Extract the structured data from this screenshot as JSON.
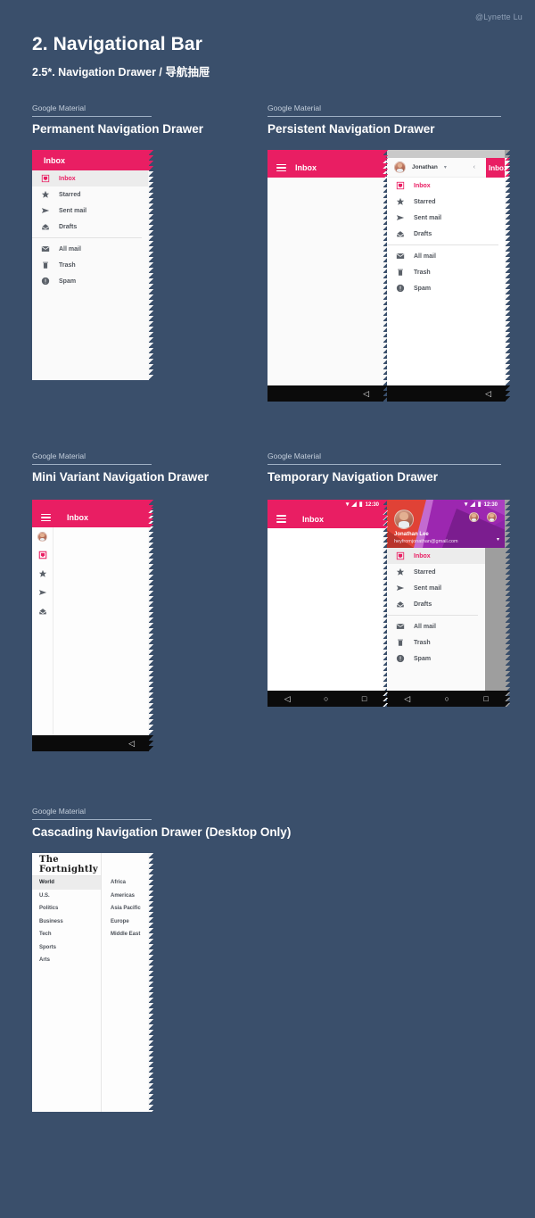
{
  "meta": {
    "author": "@Lynette Lu",
    "title": "2. Navigational Bar",
    "subtitle": "2.5*. Navigation Drawer / 导航抽屉",
    "kicker": "Google Material",
    "accent_pink": "#E91E63",
    "background": "#3A4F6B"
  },
  "sections": [
    {
      "kicker": "Google Material",
      "title": "Permanent Navigation Drawer"
    },
    {
      "kicker": "Google Material",
      "title": "Persistent Navigation Drawer"
    },
    {
      "kicker": "Google Material",
      "title": "Mini Variant Navigation Drawer"
    },
    {
      "kicker": "Google Material",
      "title": "Temporary Navigation Drawer"
    },
    {
      "kicker": "Google Material",
      "title": "Cascading Navigation Drawer (Desktop Only)"
    }
  ],
  "appbar": {
    "title": "Inbox",
    "menu_icon": "hamburger-icon"
  },
  "statusbar": {
    "time": "12:30",
    "wifi_icon": "wifi-icon",
    "signal_icon": "signal-icon",
    "battery_icon": "battery-icon"
  },
  "androidnav": {
    "back": "back-icon",
    "home": "home-icon",
    "recents": "recents-icon"
  },
  "mail_items": [
    {
      "label": "Inbox",
      "icon": "inbox-icon",
      "selected": true
    },
    {
      "label": "Starred",
      "icon": "star-icon",
      "selected": false
    },
    {
      "label": "Sent mail",
      "icon": "send-icon",
      "selected": false
    },
    {
      "label": "Drafts",
      "icon": "drafts-icon",
      "selected": false
    },
    {
      "label": "All mail",
      "icon": "mail-icon",
      "selected": false
    },
    {
      "label": "Trash",
      "icon": "trash-icon",
      "selected": false
    },
    {
      "label": "Spam",
      "icon": "info-icon",
      "selected": false
    }
  ],
  "mini_icons": [
    "avatar-icon",
    "inbox-icon",
    "star-icon",
    "send-icon",
    "drafts-icon"
  ],
  "persistent_account": {
    "name": "Jonathan",
    "caret": "▾",
    "collapse_icon": "‹"
  },
  "temporary_account": {
    "name": "Jonathan Lee",
    "email": "heyfromjonathan@gmail.com",
    "caret": "▾"
  },
  "cascading": {
    "masthead": "The Fortnightly",
    "primary": [
      "World",
      "U.S.",
      "Politics",
      "Business",
      "Tech",
      "Sports",
      "Arts"
    ],
    "selected_primary": "World",
    "secondary": [
      "Africa",
      "Americas",
      "Asia Pacific",
      "Europe",
      "Middle East"
    ]
  }
}
